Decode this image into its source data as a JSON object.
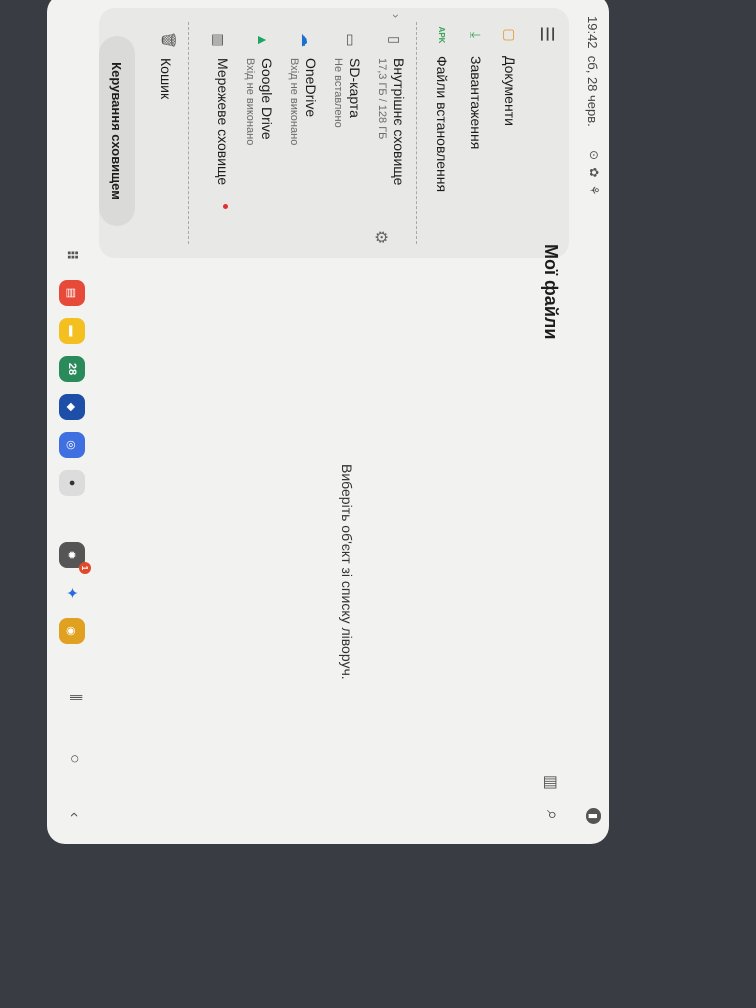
{
  "status": {
    "time": "19:42",
    "date": "сб, 28 черв."
  },
  "app": {
    "title": "Мої файли",
    "empty_hint": "Виберіть об'єкт зі списку ліворуч."
  },
  "nav": {
    "items": [
      {
        "label": "Документи",
        "icon": "document-icon"
      },
      {
        "label": "Завантаження",
        "icon": "download-icon"
      },
      {
        "label": "Файли встановлення",
        "icon": "apk-icon",
        "icon_text": "APK"
      }
    ]
  },
  "storage": {
    "items": [
      {
        "name": "Внутрішнє сховище",
        "sub": "17,3 ГБ / 128 ГБ",
        "icon": "phone-icon"
      },
      {
        "name": "SD-карта",
        "sub": "Не вставлено",
        "icon": "sd-card-icon"
      },
      {
        "name": "OneDrive",
        "sub": "Вхід не виконано",
        "icon": "onedrive-icon"
      },
      {
        "name": "Google Drive",
        "sub": "Вхід не виконано",
        "icon": "google-drive-icon"
      },
      {
        "name": "Мережеве сховище",
        "sub": "",
        "icon": "network-storage-icon"
      }
    ],
    "trash": "Кошик",
    "manage_button": "Керування сховищем"
  },
  "taskbar": {
    "calendar_day": "28",
    "badge": "1"
  },
  "colors": {
    "accent_red": "#e03030",
    "onedrive": "#1e6fd0",
    "google_drive_green": "#1fa463",
    "apk_green": "#3aa55c"
  }
}
